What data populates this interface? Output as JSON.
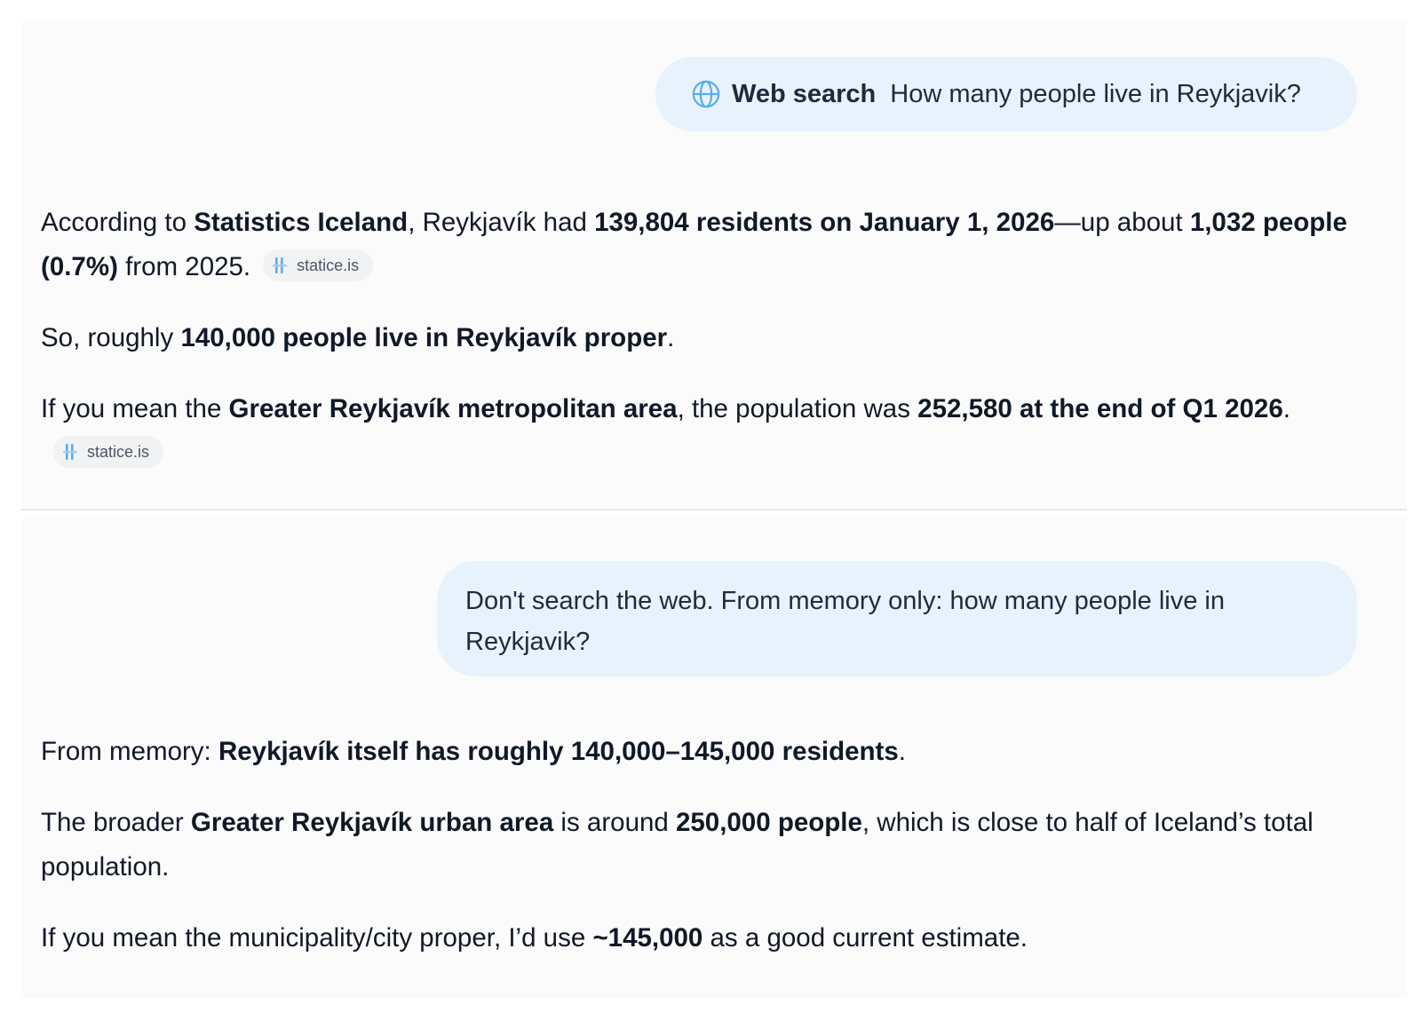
{
  "conversation": {
    "turn1": {
      "query": {
        "mode_icon": "globe-icon",
        "mode_label": "Web search",
        "text": "How many people live in Reykjavik?"
      },
      "response": {
        "p1": {
          "t1": "According to ",
          "b1": "Statistics Iceland",
          "t2": ", Reykjavík had ",
          "b2": "139,804 residents on January 1, 2026",
          "t3": "—up about ",
          "b3": "1,032 people (0.7%)",
          "t4": " from 2025.",
          "source": "statice.is"
        },
        "p2": {
          "t1": "So, roughly ",
          "b1": "140,000 people live in Reykjavík proper",
          "t2": "."
        },
        "p3": {
          "t1": "If you mean the ",
          "b1": "Greater Reykjavík metropolitan area",
          "t2": ", the population was ",
          "b2": "252,580 at the end of Q1 2026",
          "t3": ".",
          "source": "statice.is"
        }
      }
    },
    "turn2": {
      "query": {
        "text": "Don't search the web. From memory only: how many people live in Reykjavik?"
      },
      "response": {
        "p1": {
          "t1": "From memory: ",
          "b1": "Reykjavík itself has roughly 140,000–145,000 residents",
          "t2": "."
        },
        "p2": {
          "t1": "The broader ",
          "b1": "Greater Reykjavík urban area",
          "t2": " is around ",
          "b2": "250,000 people",
          "t3": ", which is close to half of Iceland’s total population."
        },
        "p3": {
          "t1": "If you mean the municipality/city proper, I’d use ",
          "b1": "~145,000",
          "t2": " as a good current estimate."
        }
      }
    }
  },
  "colors": {
    "bubble_bg": "#e8f2fd",
    "accent_icon": "#5aaee8",
    "text": "#111827"
  }
}
